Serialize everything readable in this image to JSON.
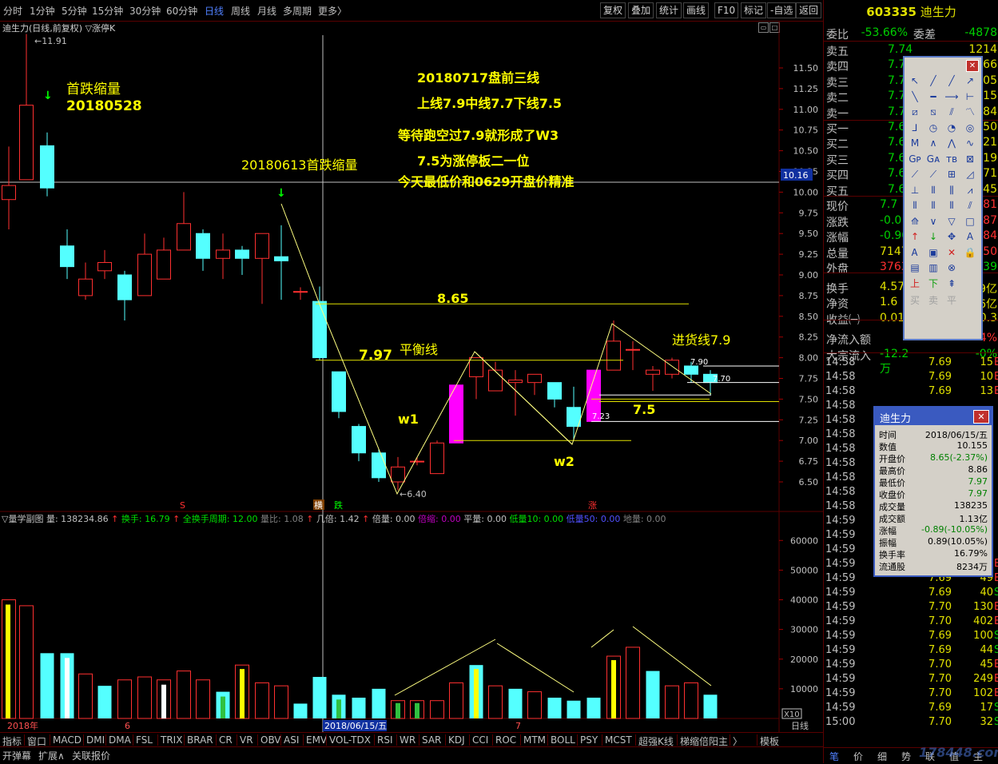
{
  "period_tabs": [
    {
      "label": "分时",
      "active": false
    },
    {
      "label": "1分钟",
      "active": false
    },
    {
      "label": "5分钟",
      "active": false
    },
    {
      "label": "15分钟",
      "active": false
    },
    {
      "label": "30分钟",
      "active": false
    },
    {
      "label": "60分钟",
      "active": false
    },
    {
      "label": "日线",
      "active": true
    },
    {
      "label": "周线",
      "active": false
    },
    {
      "label": "月线",
      "active": false
    },
    {
      "label": "多周期",
      "active": false
    },
    {
      "label": "更多〉",
      "active": false
    }
  ],
  "tool_buttons": [
    "复权",
    "叠加",
    "统计",
    "画线",
    "F10",
    "标记",
    "-自选",
    "返回"
  ],
  "chart_title": "迪生力(日线,前复权) ▽涨停K",
  "volume_title": "▽量学副图",
  "volume_indicators": [
    {
      "label": "量: 138234.86",
      "color": "#c0c0c0"
    },
    {
      "label": "↑",
      "color": "#ff3030"
    },
    {
      "label": "换手: 16.79",
      "color": "#00e000"
    },
    {
      "label": "↑",
      "color": "#ff3030"
    },
    {
      "label": "全换手周期: 12.00",
      "color": "#00e000"
    },
    {
      "label": "量比: 1.08",
      "color": "#808080"
    },
    {
      "label": "↑",
      "color": "#ff3030"
    },
    {
      "label": "几倍: 1.42",
      "color": "#c0c0c0"
    },
    {
      "label": "↑",
      "color": "#ff3030"
    },
    {
      "label": "倍量: 0.00",
      "color": "#c0c0c0"
    },
    {
      "label": "倍缩: 0.00",
      "color": "#c000c0"
    },
    {
      "label": "平量: 0.00",
      "color": "#c0c0c0"
    },
    {
      "label": "低量10: 0.00",
      "color": "#00e000"
    },
    {
      "label": "低量50: 0.00",
      "color": "#5050ff"
    },
    {
      "label": "地量: 0.00",
      "color": "#808080"
    }
  ],
  "annotations": {
    "a1": "首跌缩量",
    "a2": "20180528",
    "a3": "20180613首跌缩量",
    "a4": "20180717盘前三线",
    "a5": "上线7.9中线7.7下线7.5",
    "a6": "等待跑空过7.9就形成了W3",
    "a7": "7.5为涨停板二一位",
    "a8": "今天最低价和0629开盘价精准",
    "a9": "8.65",
    "a10": "7.97",
    "a11": "平衡线",
    "a12": "w1",
    "a13": "w2",
    "a14": "7.5",
    "a15": "进货线7.9",
    "hi_label": "11.91",
    "lo_label": "6.40",
    "l790": "7.90",
    "l770": "7.70",
    "l723": "7.23",
    "cursor_price": "10.16",
    "marker_s": "S",
    "marker_fall1": "横",
    "marker_fall2": "跌",
    "marker_rise": "涨",
    "x10": "X10",
    "date_2018": "2018年",
    "date_6": "6",
    "date_7": "7",
    "cursor_date": "2018/06/15/五",
    "period_label": "日线"
  },
  "chart_data": {
    "type": "candlestick",
    "ylim": [
      6.3,
      11.95
    ],
    "y_ticks": [
      "11.50",
      "11.25",
      "11.00",
      "10.75",
      "10.50",
      "10.25",
      "10.00",
      "9.75",
      "9.50",
      "9.25",
      "9.00",
      "8.75",
      "8.50",
      "8.25",
      "8.00",
      "7.75",
      "7.50",
      "7.25",
      "7.00",
      "6.75",
      "6.50"
    ],
    "candles": [
      {
        "o": 9.91,
        "c": 10.08,
        "h": 10.55,
        "l": 9.55
      },
      {
        "o": 10.15,
        "c": 11.05,
        "h": 11.91,
        "l": 10.15
      },
      {
        "o": 10.56,
        "c": 10.05,
        "h": 10.72,
        "l": 9.95
      },
      {
        "o": 9.35,
        "c": 9.1,
        "h": 9.55,
        "l": 8.95
      },
      {
        "o": 8.75,
        "c": 8.95,
        "h": 9.15,
        "l": 8.7
      },
      {
        "o": 9.05,
        "c": 9.15,
        "h": 9.3,
        "l": 8.95
      },
      {
        "o": 9.0,
        "c": 8.7,
        "h": 9.05,
        "l": 8.45
      },
      {
        "o": 8.75,
        "c": 9.25,
        "h": 9.5,
        "l": 8.75
      },
      {
        "o": 8.95,
        "c": 9.3,
        "h": 9.45,
        "l": 8.95
      },
      {
        "o": 9.3,
        "c": 9.62,
        "h": 10.0,
        "l": 9.3
      },
      {
        "o": 9.5,
        "c": 9.2,
        "h": 9.55,
        "l": 9.05
      },
      {
        "o": 9.2,
        "c": 9.3,
        "h": 9.5,
        "l": 8.95
      },
      {
        "o": 9.3,
        "c": 9.2,
        "h": 9.35,
        "l": 9.0
      },
      {
        "o": 9.2,
        "c": 9.5,
        "h": 9.5,
        "l": 8.65
      },
      {
        "o": 9.22,
        "c": 9.17,
        "h": 9.6,
        "l": 8.7
      },
      {
        "o": 8.8,
        "c": 8.8,
        "h": 8.85,
        "l": 8.7
      },
      {
        "o": 8.68,
        "c": 8.0,
        "h": 8.86,
        "l": 7.97
      },
      {
        "o": 7.83,
        "c": 7.35,
        "h": 7.83,
        "l": 7.27
      },
      {
        "o": 7.17,
        "c": 6.85,
        "h": 7.2,
        "l": 6.75
      },
      {
        "o": 6.85,
        "c": 6.55,
        "h": 6.9,
        "l": 6.5
      },
      {
        "o": 6.5,
        "c": 6.68,
        "h": 6.8,
        "l": 6.4
      },
      {
        "o": 6.75,
        "c": 6.75,
        "h": 6.8,
        "l": 6.7
      },
      {
        "o": 6.6,
        "c": 6.97,
        "h": 7.0,
        "l": 6.6
      },
      {
        "o": 6.97,
        "c": 7.67,
        "h": 7.67,
        "l": 6.97
      },
      {
        "o": 7.77,
        "c": 8.0,
        "h": 8.0,
        "l": 7.5
      },
      {
        "o": 7.6,
        "c": 7.85,
        "h": 7.95,
        "l": 7.6
      },
      {
        "o": 7.7,
        "c": 7.73,
        "h": 7.85,
        "l": 7.3
      },
      {
        "o": 7.7,
        "c": 7.8,
        "h": 7.8,
        "l": 7.55
      },
      {
        "o": 7.7,
        "c": 7.5,
        "h": 7.7,
        "l": 7.4
      },
      {
        "o": 7.4,
        "c": 7.17,
        "h": 7.65,
        "l": 7.0
      },
      {
        "o": 7.23,
        "c": 7.85,
        "h": 7.85,
        "l": 7.23
      },
      {
        "o": 7.85,
        "c": 8.2,
        "h": 8.45,
        "l": 7.85
      },
      {
        "o": 8.1,
        "c": 8.1,
        "h": 8.2,
        "l": 7.85
      },
      {
        "o": 7.8,
        "c": 7.85,
        "h": 7.9,
        "l": 7.6
      },
      {
        "o": 7.8,
        "c": 7.97,
        "h": 8.0,
        "l": 7.75
      },
      {
        "o": 7.9,
        "c": 7.8,
        "h": 7.95,
        "l": 7.7
      },
      {
        "o": 7.8,
        "c": 7.7,
        "h": 7.85,
        "l": 7.55
      }
    ],
    "volume_ylim": [
      0,
      66000
    ],
    "volume_ticks": [
      "60000",
      "50000",
      "40000",
      "30000",
      "20000",
      "10000"
    ],
    "volumes": [
      {
        "v": 40000,
        "type": "mark"
      },
      {
        "v": 38000,
        "type": "red"
      },
      {
        "v": 22000,
        "type": "cyan"
      },
      {
        "v": 22000,
        "type": "mark2"
      },
      {
        "v": 15000,
        "type": "red"
      },
      {
        "v": 11000,
        "type": "cyan"
      },
      {
        "v": 13000,
        "type": "red"
      },
      {
        "v": 14000,
        "type": "red"
      },
      {
        "v": 13000,
        "type": "mark3"
      },
      {
        "v": 16000,
        "type": "red"
      },
      {
        "v": 13000,
        "type": "red"
      },
      {
        "v": 9000,
        "type": "mark4"
      },
      {
        "v": 18000,
        "type": "mark5"
      },
      {
        "v": 12000,
        "type": "red"
      },
      {
        "v": 11000,
        "type": "red"
      },
      {
        "v": 5000,
        "type": "cyan"
      },
      {
        "v": 14000,
        "type": "cyan"
      },
      {
        "v": 8000,
        "type": "mark4"
      },
      {
        "v": 7000,
        "type": "cyan"
      },
      {
        "v": 10000,
        "type": "cyan"
      },
      {
        "v": 6000,
        "type": "mark6"
      },
      {
        "v": 6000,
        "type": "mark6"
      },
      {
        "v": 6000,
        "type": "red"
      },
      {
        "v": 12000,
        "type": "red"
      },
      {
        "v": 18000,
        "type": "mark7"
      },
      {
        "v": 11000,
        "type": "red"
      },
      {
        "v": 10000,
        "type": "cyan"
      },
      {
        "v": 9000,
        "type": "red"
      },
      {
        "v": 7000,
        "type": "cyan"
      },
      {
        "v": 6000,
        "type": "cyan"
      },
      {
        "v": 7000,
        "type": "cyan"
      },
      {
        "v": 21000,
        "type": "mark5"
      },
      {
        "v": 24000,
        "type": "red"
      },
      {
        "v": 16000,
        "type": "cyan"
      },
      {
        "v": 11000,
        "type": "red"
      },
      {
        "v": 12000,
        "type": "red"
      },
      {
        "v": 8000,
        "type": "cyan"
      },
      {
        "v": 7000,
        "type": "cyan"
      }
    ]
  },
  "indicator_tabs": [
    "指标",
    "窗口",
    "MACD",
    "DMI",
    "DMA",
    "FSL",
    "TRIX",
    "BRAR",
    "CR",
    "VR",
    "OBV",
    "ASI",
    "EMV",
    "VOL-TDX",
    "RSI",
    "WR",
    "SAR",
    "KDJ",
    "CCI",
    "ROC",
    "MTM",
    "BOLL",
    "PSY",
    "MCST",
    "超强K线",
    "梯缩倍阳主",
    "〉",
    "模板"
  ],
  "footer_tabs": [
    "开弹幕",
    "扩展∧",
    "关联报价"
  ],
  "stock": {
    "code": "603335",
    "name": "迪生力"
  },
  "quote_top": [
    {
      "label": "委比",
      "value": "-53.66%",
      "vcolor": "#00d000",
      "label2": "委差",
      "value2": "-4878",
      "v2color": "#00d000"
    }
  ],
  "order_book": [
    {
      "label": "卖五",
      "price": "7.74",
      "pcolor": "#00d000",
      "vol": "1214"
    },
    {
      "label": "卖四",
      "price": "7.7",
      "pcolor": "#00d000",
      "vol": "066"
    },
    {
      "label": "卖三",
      "price": "7.7",
      "pcolor": "#00d000",
      "vol": "305"
    },
    {
      "label": "卖二",
      "price": "7.7",
      "pcolor": "#00d000",
      "vol": "215"
    },
    {
      "label": "卖一",
      "price": "7.7",
      "pcolor": "#00d000",
      "vol": "184"
    },
    {
      "label": "买一",
      "price": "7.6",
      "pcolor": "#00d000",
      "vol": "250"
    },
    {
      "label": "买二",
      "price": "7.6",
      "pcolor": "#00d000",
      "vol": "221"
    },
    {
      "label": "买三",
      "price": "7.6",
      "pcolor": "#00d000",
      "vol": "119"
    },
    {
      "label": "买四",
      "price": "7.6",
      "pcolor": "#00d000",
      "vol": "371"
    },
    {
      "label": "买五",
      "price": "7.6",
      "pcolor": "#00d000",
      "vol": "145"
    }
  ],
  "stats": [
    {
      "label": "现价",
      "value": "7.7",
      "vcolor": "#00d000",
      "value2": ".81",
      "v2color": "#ff3030"
    },
    {
      "label": "涨跌",
      "value": "-0.0",
      "vcolor": "#00d000",
      "value2": ".87",
      "v2color": "#ff3030"
    },
    {
      "label": "涨幅",
      "value": "-0.90",
      "vcolor": "#00d000",
      "value2": ".84",
      "v2color": "#ff3030"
    },
    {
      "label": "总量",
      "value": "7147",
      "vcolor": "#e0e000",
      "value2": ".50",
      "v2color": "#ff3030"
    },
    {
      "label": "外盘",
      "value": "3763",
      "vcolor": "#ff3030",
      "value2": "839",
      "v2color": "#00d000"
    },
    {
      "label": "换手",
      "value": "4.57",
      "vcolor": "#e0e000",
      "value2": "9亿",
      "v2color": "#e0e000"
    },
    {
      "label": "净资",
      "value": "1.6",
      "vcolor": "#e0e000",
      "value2": "6亿",
      "v2color": "#e0e000"
    },
    {
      "label": "收益㈠",
      "value": "0.01",
      "vcolor": "#e0e000",
      "value2": "0.3",
      "v2color": "#e0e000"
    },
    {
      "label": "净流入额",
      "value": "",
      "vcolor": "#e0e000",
      "value2": "4%",
      "v2color": "#ff3030"
    },
    {
      "label": "大宗流入",
      "value": "-12.2万",
      "vcolor": "#00d000",
      "value2": "-0%",
      "v2color": "#00d000"
    }
  ],
  "ticks": [
    {
      "t": "14:58",
      "p": "7.69",
      "v": "15",
      "f": "B"
    },
    {
      "t": "14:58",
      "p": "7.69",
      "v": "10",
      "f": "B"
    },
    {
      "t": "14:58",
      "p": "7.69",
      "v": "13",
      "f": "B"
    },
    {
      "t": "14:58",
      "p": "",
      "v": "",
      "f": ""
    },
    {
      "t": "14:58",
      "p": "",
      "v": "",
      "f": ""
    },
    {
      "t": "14:58",
      "p": "",
      "v": "",
      "f": ""
    },
    {
      "t": "14:58",
      "p": "",
      "v": "",
      "f": ""
    },
    {
      "t": "14:58",
      "p": "",
      "v": "",
      "f": ""
    },
    {
      "t": "14:58",
      "p": "",
      "v": "",
      "f": ""
    },
    {
      "t": "14:58",
      "p": "",
      "v": "",
      "f": ""
    },
    {
      "t": "14:58",
      "p": "",
      "v": "",
      "f": ""
    },
    {
      "t": "14:59",
      "p": "",
      "v": "",
      "f": ""
    },
    {
      "t": "14:59",
      "p": "",
      "v": "",
      "f": ""
    },
    {
      "t": "14:59",
      "p": "",
      "v": "",
      "f": ""
    },
    {
      "t": "14:59",
      "p": "7.69",
      "v": "20",
      "f": "B"
    },
    {
      "t": "14:59",
      "p": "7.69",
      "v": "49",
      "f": "B"
    },
    {
      "t": "14:59",
      "p": "7.69",
      "v": "40",
      "f": "S"
    },
    {
      "t": "14:59",
      "p": "7.70",
      "v": "130",
      "f": "B"
    },
    {
      "t": "14:59",
      "p": "7.70",
      "v": "402",
      "f": "B"
    },
    {
      "t": "14:59",
      "p": "7.69",
      "v": "100",
      "f": "S"
    },
    {
      "t": "14:59",
      "p": "7.69",
      "v": "44",
      "f": "S"
    },
    {
      "t": "14:59",
      "p": "7.70",
      "v": "45",
      "f": "B"
    },
    {
      "t": "14:59",
      "p": "7.70",
      "v": "249",
      "f": "B"
    },
    {
      "t": "14:59",
      "p": "7.70",
      "v": "102",
      "f": "B"
    },
    {
      "t": "14:59",
      "p": "7.69",
      "v": "17",
      "f": "S"
    },
    {
      "t": "15:00",
      "p": "7.70",
      "v": "32",
      "f": "S"
    }
  ],
  "right_bottom_tabs": [
    "笔",
    "价",
    "细",
    "势",
    "联",
    "值",
    "主"
  ],
  "info_box": {
    "title": "迪生力",
    "rows": [
      {
        "k": "时间",
        "v": "2018/06/15/五",
        "vcolor": "#000000"
      },
      {
        "k": "数值",
        "v": "10.155",
        "vcolor": "#000000"
      },
      {
        "k": "开盘价",
        "v": "8.65(-2.37%)",
        "vcolor": "#008000"
      },
      {
        "k": "最高价",
        "v": "8.86",
        "vcolor": "#000000"
      },
      {
        "k": "最低价",
        "v": "7.97",
        "vcolor": "#008000"
      },
      {
        "k": "收盘价",
        "v": "7.97",
        "vcolor": "#008000"
      },
      {
        "k": "成交量",
        "v": "138235",
        "vcolor": "#000000"
      },
      {
        "k": "成交额",
        "v": "1.13亿",
        "vcolor": "#000000"
      },
      {
        "k": "涨幅",
        "v": "-0.89(-10.05%)",
        "vcolor": "#008000"
      },
      {
        "k": "振幅",
        "v": "0.89(10.05%)",
        "vcolor": "#000000"
      },
      {
        "k": "换手率",
        "v": "16.79%",
        "vcolor": "#000000"
      },
      {
        "k": "流通股",
        "v": "8234万",
        "vcolor": "#000000"
      }
    ]
  },
  "tool_palette_icons": [
    "pointer-icon",
    "line-icon",
    "ray-icon",
    "arrow-ray-icon",
    "segment-icon",
    "hline-icon",
    "hray-icon",
    "price-line-icon",
    "parallel-icon",
    "channel-icon",
    "channel2-icon",
    "wave-icon",
    "fib-icon",
    "circle-icon",
    "arc-icon",
    "target-icon",
    "wave2-icon",
    "wave3-icon",
    "wave4-icon",
    "wave5-icon",
    "gp-icon",
    "ga-icon",
    "tb-icon",
    "rect-icon",
    "gann-icon",
    "gann2-icon",
    "grid-icon",
    "fan-icon",
    "period-icon",
    "period2-icon",
    "period3-icon",
    "period4-icon",
    "bars-icon",
    "bars2-icon",
    "bars3-icon",
    "bars4-icon",
    "speed-icon",
    "down-icon",
    "triangle-icon",
    "box-icon",
    "up-arrow-icon",
    "down-arrow-icon",
    "move-icon",
    "text-icon",
    "text2-icon",
    "cube-icon",
    "delete-icon",
    "lock-icon",
    "note-icon",
    "note2-icon",
    "ban-icon",
    "",
    "up-flag-icon",
    "down-flag-icon",
    "mark-icon",
    ""
  ],
  "tool_palette_bottom": [
    "买",
    "卖",
    "平"
  ],
  "tool_palette_extra": {
    "up": "上",
    "down": "下",
    "t": "A",
    "t2": "A"
  },
  "watermark": "178448.com"
}
